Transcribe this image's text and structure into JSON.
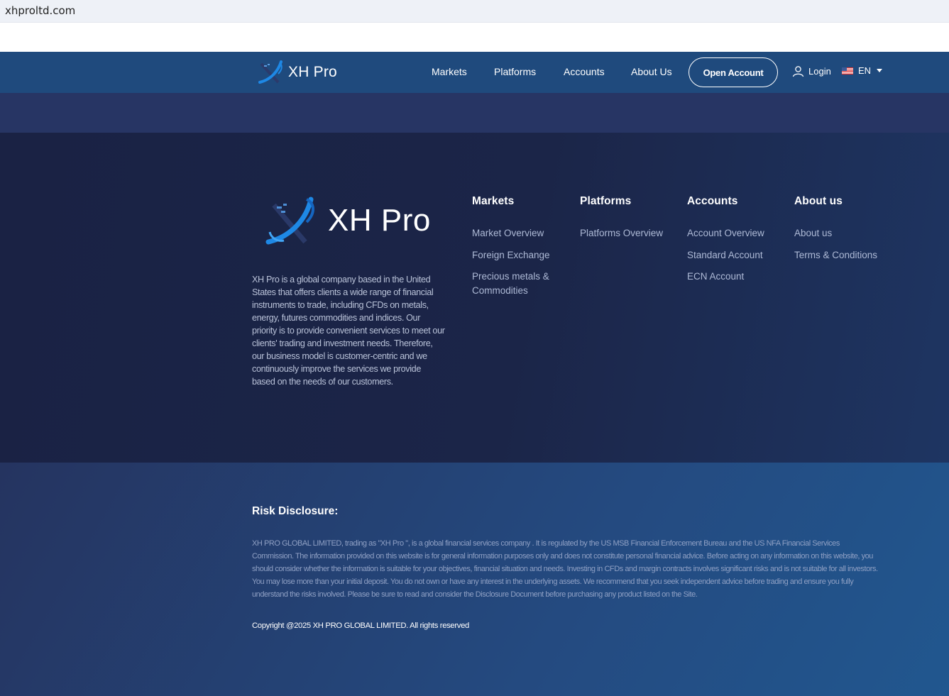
{
  "browser": {
    "url": "xhproltd.com"
  },
  "header": {
    "logo_text": "XH Pro",
    "nav": [
      "Markets",
      "Platforms",
      "Accounts",
      "About Us"
    ],
    "open_account_label": "Open Account",
    "login_label": "Login",
    "language": "EN",
    "icons": {
      "login": "user-icon",
      "language_flag": "us-flag-icon",
      "language_caret": "caret-down-icon"
    },
    "colors": {
      "header_bg": "#1f4a7d",
      "accent_blue": "#1e88e5"
    }
  },
  "footer": {
    "logo_text": "XH Pro",
    "about_text": "XH Pro is a global company based in the United States that offers clients a wide range of financial instruments to trade, including CFDs on metals, energy, futures commodities and indices. Our priority is to provide convenient services to meet our clients' trading and investment needs. Therefore, our business model is customer-centric and we continuously improve the services we provide based on the needs of our customers.",
    "columns": [
      {
        "title": "Markets",
        "links": [
          "Market Overview",
          "Foreign Exchange",
          "Precious metals & Commodities"
        ]
      },
      {
        "title": "Platforms",
        "links": [
          "Platforms Overview"
        ]
      },
      {
        "title": "Accounts",
        "links": [
          "Account Overview",
          "Standard Account",
          "ECN Account"
        ]
      },
      {
        "title": "About us",
        "links": [
          "About us",
          "Terms & Conditions"
        ]
      }
    ]
  },
  "risk": {
    "title": "Risk Disclosure:",
    "text": "XH PRO GLOBAL LIMITED, trading as \"XH Pro \", is a global financial services company . It is regulated by the US MSB Financial Enforcement Bureau and the US NFA Financial Services Commission. The information provided on this website is for general information purposes only and does not constitute personal financial advice. Before acting on any information on this website, you should consider whether the information is suitable for your objectives, financial situation and needs. Investing in CFDs and margin contracts involves significant risks and is not suitable for all investors. You may lose more than your initial deposit. You do not own or have any interest in the underlying assets. We recommend that you seek independent advice before trading and ensure you fully understand the risks involved. Please be sure to read and consider the Disclosure Document before purchasing any product listed on the Site.",
    "copyright": "Copyright @2025 XH PRO GLOBAL LIMITED. All rights reserved"
  }
}
